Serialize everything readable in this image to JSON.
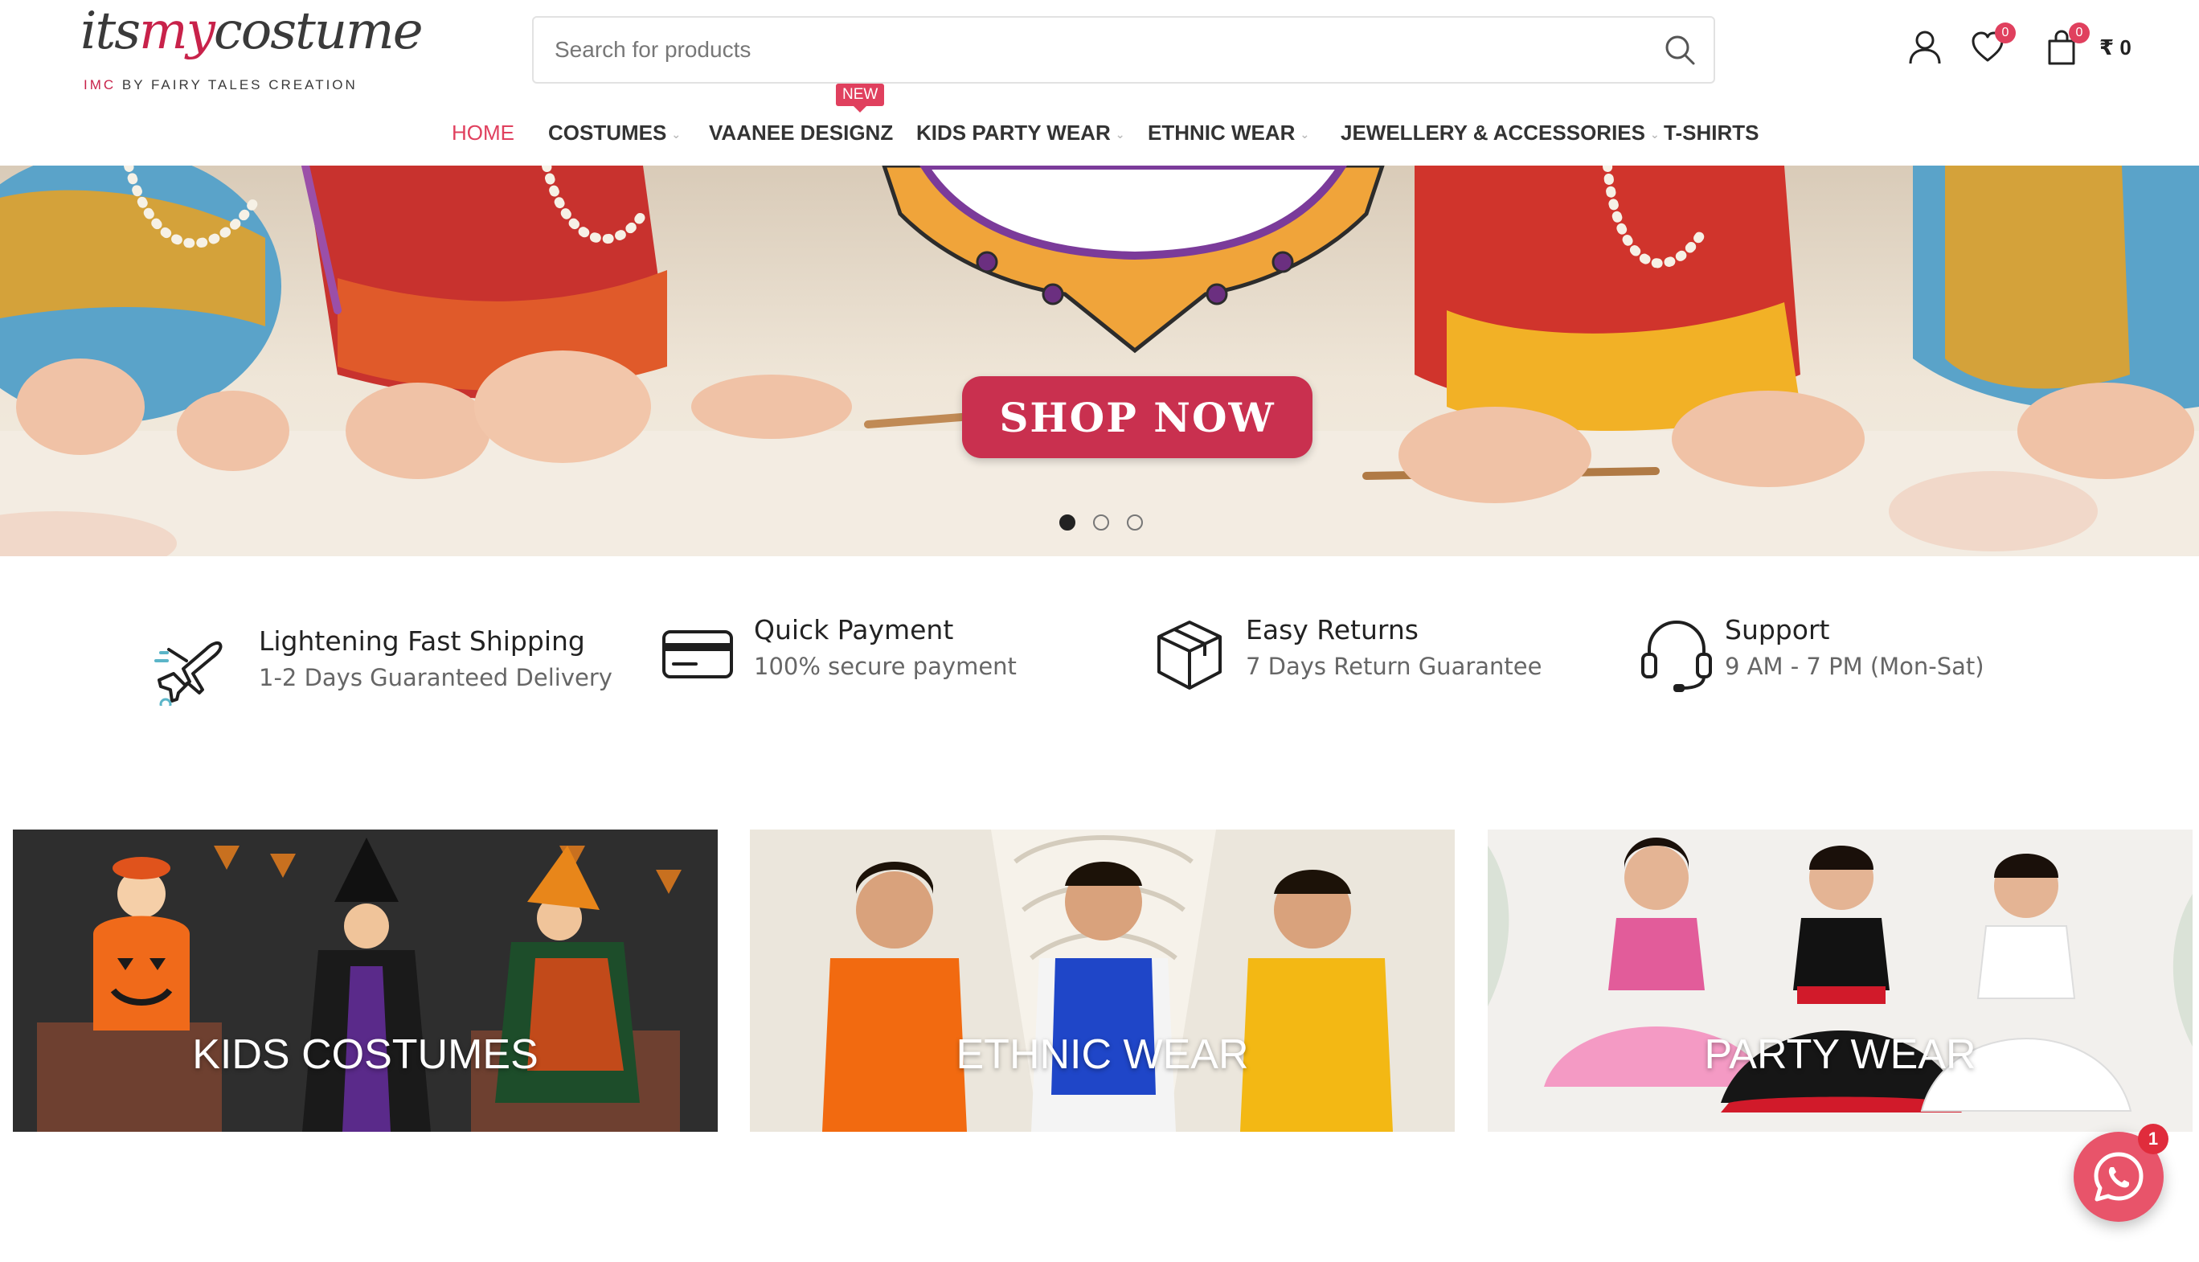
{
  "header": {
    "logo": {
      "prefix": "its",
      "accent": "my",
      "suffix": "costume",
      "tag_accent": "IMC",
      "tag_rest": " BY FAIRY TALES CREATION"
    },
    "search": {
      "placeholder": "Search for products",
      "value": ""
    },
    "wishlist_count": "0",
    "cart_count": "0",
    "cart_total": "₹ 0",
    "icons": [
      "user-icon",
      "heart-icon",
      "bag-icon",
      "search-icon"
    ]
  },
  "nav": {
    "items": [
      {
        "label": "HOME",
        "active": true
      },
      {
        "label": "COSTUMES",
        "has_dropdown": true
      },
      {
        "label": "VAANEE DESIGNZ",
        "tag": "NEW"
      },
      {
        "label": "KIDS PARTY WEAR",
        "has_dropdown": true
      },
      {
        "label": "ETHNIC WEAR",
        "has_dropdown": true
      },
      {
        "label": "JEWELLERY & ACCESSORIES",
        "has_dropdown": true
      },
      {
        "label": "T-SHIRTS"
      }
    ]
  },
  "hero": {
    "button_label": "SHOP NOW",
    "slides": 3,
    "active_slide": 1
  },
  "features": [
    {
      "icon": "airplane-icon",
      "title": "Lightening Fast Shipping",
      "subtitle": "1-2 Days Guaranteed Delivery"
    },
    {
      "icon": "credit-card-icon",
      "title": "Quick Payment",
      "subtitle": "100% secure payment"
    },
    {
      "icon": "box-icon",
      "title": "Easy Returns",
      "subtitle": "7 Days Return Guarantee"
    },
    {
      "icon": "headset-icon",
      "title": "Support",
      "subtitle": "9 AM - 7 PM (Mon-Sat)"
    }
  ],
  "categories": [
    {
      "label": "KIDS COSTUMES"
    },
    {
      "label": "ETHNIC WEAR"
    },
    {
      "label": "PARTY WEAR"
    }
  ],
  "chat": {
    "icon": "whatsapp-icon",
    "badge": "1"
  },
  "colors": {
    "accent": "#e0405e",
    "button": "#c9304f",
    "text": "#333333"
  }
}
